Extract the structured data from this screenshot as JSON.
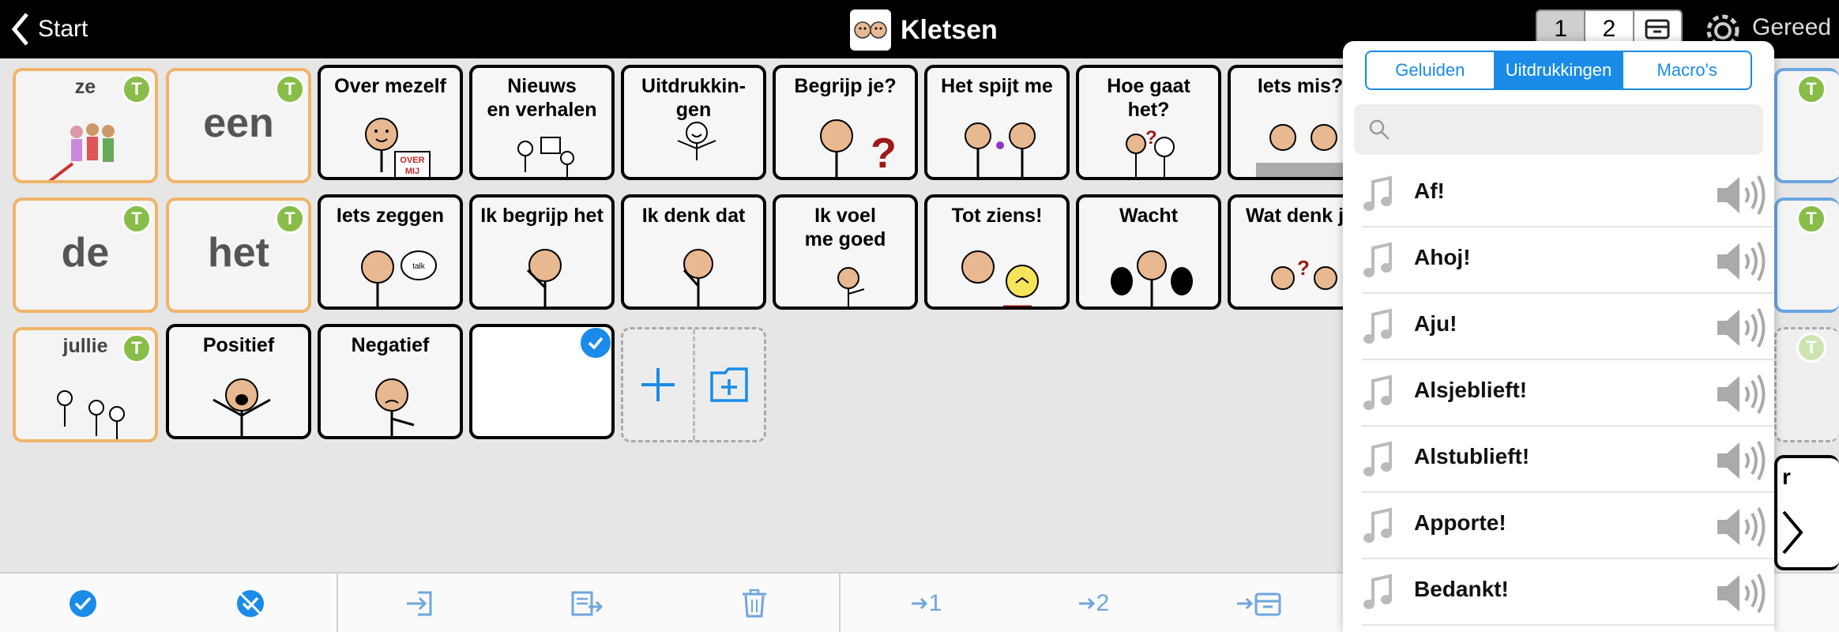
{
  "topbar": {
    "back_label": "Start",
    "title": "Kletsen",
    "pages": [
      "1",
      "2"
    ],
    "done_label": "Gereed"
  },
  "tiles": {
    "ze": "ze",
    "een": "een",
    "over_mezelf": "Over mezelf",
    "nieuws": "Nieuws\nen verhalen",
    "uitdrukkingen": "Uitdrukkin-\ngen",
    "begrijp": "Begrijp je?",
    "spijt": "Het spijt me",
    "hoe_gaat": "Hoe gaat\nhet?",
    "iets_mis": "Iets mis?",
    "de": "de",
    "het": "het",
    "iets_zeggen": "Iets zeggen",
    "ik_begrijp": "Ik begrijp het",
    "ik_denk": "Ik denk dat",
    "ik_voel": "Ik voel\nme goed",
    "tot_ziens": "Tot ziens!",
    "wacht": "Wacht",
    "wat_denk": "Wat denk je",
    "jullie": "jullie",
    "positief": "Positief",
    "negatief": "Negatief",
    "badge": "T",
    "overmij": "OVER MIJ",
    "talk": "talk"
  },
  "popover": {
    "tabs": [
      "Geluiden",
      "Uitdrukkingen",
      "Macro's"
    ],
    "active_tab": "Uitdrukkingen",
    "search_placeholder": "",
    "items": [
      "Af!",
      "Ahoj!",
      "Aju!",
      "Alsjeblieft!",
      "Alstublieft!",
      "Apporte!",
      "Bedankt!"
    ]
  },
  "peek": {
    "letter": "r"
  },
  "colors": {
    "accent": "#1a8be8",
    "word_border": "#f0b46a",
    "badge": "#87bd48"
  }
}
